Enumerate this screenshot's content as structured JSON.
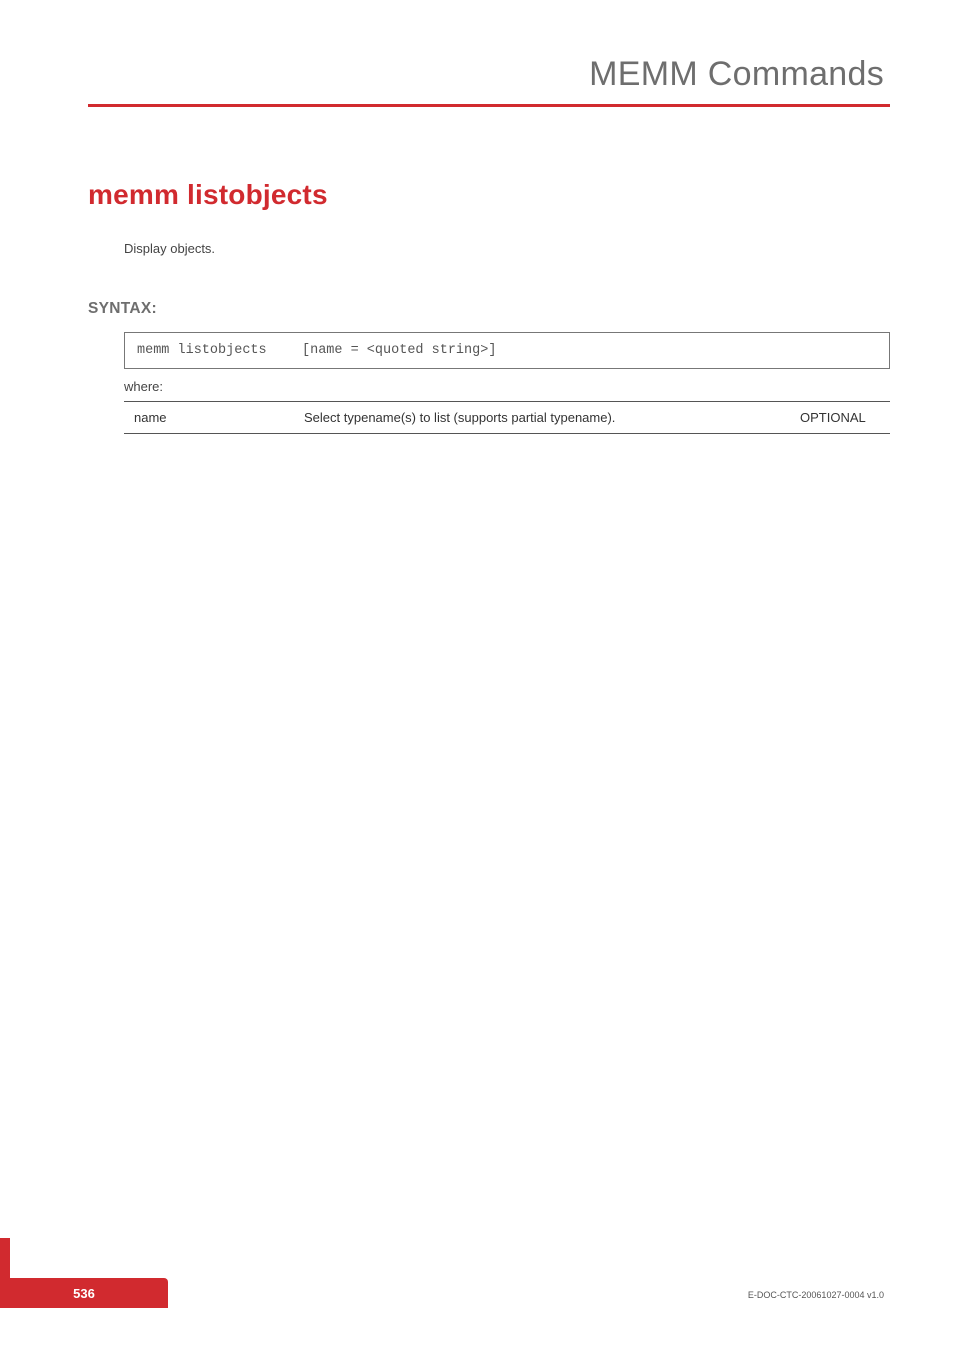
{
  "header": {
    "chapter_title": "MEMM Commands"
  },
  "content": {
    "command_title": "memm listobjects",
    "description": "Display objects.",
    "syntax_label": "SYNTAX:",
    "syntax": {
      "command": "memm listobjects",
      "args": "[name = <quoted string>]"
    },
    "where_label": "where:",
    "params": [
      {
        "name": "name",
        "desc": "Select typename(s) to list (supports partial typename).",
        "optional": "OPTIONAL"
      }
    ]
  },
  "footer": {
    "page_number": "536",
    "doc_ref": "E-DOC-CTC-20061027-0004 v1.0"
  }
}
